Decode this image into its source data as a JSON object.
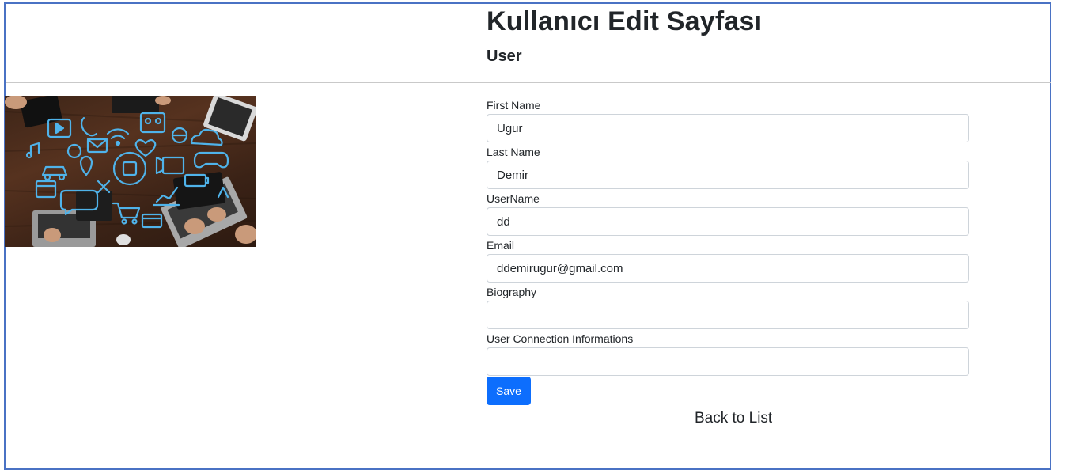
{
  "header": {
    "title": "Kullanıcı Edit Sayfası",
    "subtitle": "User"
  },
  "form": {
    "fields": [
      {
        "label": "First Name",
        "value": "Ugur"
      },
      {
        "label": "Last Name",
        "value": "Demir"
      },
      {
        "label": "UserName",
        "value": "dd"
      },
      {
        "label": "Email",
        "value": "ddemirugur@gmail.com"
      },
      {
        "label": "Biography",
        "value": ""
      },
      {
        "label": "User Connection Informations",
        "value": ""
      }
    ],
    "save_label": "Save"
  },
  "back_link_label": "Back to List",
  "colors": {
    "accent": "#0d6efd",
    "frame": "#4a72c4",
    "icon_blue": "#4fb3ea"
  }
}
